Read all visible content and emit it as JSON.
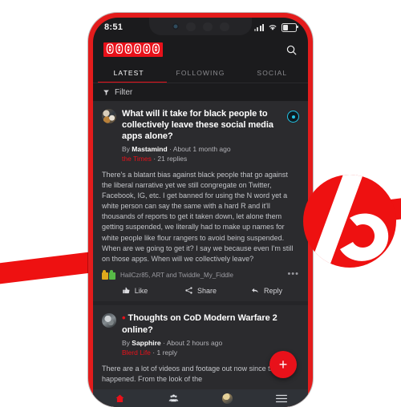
{
  "statusbar": {
    "time": "8:51",
    "signal_icon": "signal-bars-icon",
    "wifi_icon": "wifi-icon",
    "battery_icon": "battery-icon"
  },
  "appbar": {
    "logo_digits": [
      "0",
      "0",
      "0",
      "0",
      "0",
      "0"
    ],
    "logo_text": "000000",
    "search_icon": "search-icon",
    "brand_color": "#e8111a"
  },
  "tabs": [
    {
      "label": "LATEST",
      "active": true
    },
    {
      "label": "FOLLOWING",
      "active": false
    },
    {
      "label": "SOCIAL",
      "active": false
    }
  ],
  "filter": {
    "label": "Filter",
    "icon": "funnel-icon"
  },
  "posts": [
    {
      "title": "What will it take for black people to collectively leave these social media apps alone?",
      "author_prefix": "By ",
      "author": "Mastamind",
      "time": "· About 1 month ago",
      "category": "the Times",
      "replies": "· 21 replies",
      "badge_icon": "eye-icon",
      "badge_color": "#22c3e6",
      "body": "There's a blatant bias against black people that go against the liberal narrative yet we still congregate on Twitter, Facebook, IG, etc. I get banned for using the N word yet a white person can say the same with a hard R and it'll thousands of reports to get it taken down, let alone them getting suspended, we literally had to make up names for white people like flour rangers to avoid being suspended. When are we going to get it? I say we because even I'm still on those apps. When will we collectively leave?",
      "reaction_names": "HailCzr85, ART and Twiddle_My_Fiddle",
      "more_label": "•••",
      "actions": [
        {
          "label": "Like",
          "icon": "thumbs-up-icon"
        },
        {
          "label": "Share",
          "icon": "share-icon"
        },
        {
          "label": "Reply",
          "icon": "reply-arrow-icon"
        }
      ]
    },
    {
      "title": "Thoughts on CoD Modern Warfare 2 online?",
      "new_dot": "•",
      "author_prefix": "By ",
      "author": "Sapphire",
      "time": "· About 2 hours ago",
      "category": "Blerd Life",
      "replies": "· 1 reply",
      "body": "There are a lot of videos and footage out now since the beta happened. From the look of the"
    }
  ],
  "fab": {
    "label": "+",
    "icon": "plus-icon",
    "color": "#e8111a"
  },
  "bottomnav": [
    {
      "icon": "home-icon",
      "active": true
    },
    {
      "icon": "groups-icon",
      "active": false
    },
    {
      "icon": "profile-avatar-icon",
      "active": false
    },
    {
      "icon": "menu-hamburger-icon",
      "active": false
    }
  ],
  "branding": {
    "logomark_icon": "b-logo-icon",
    "logomark_color": "#ee1111",
    "stripe_color": "#ee1111"
  }
}
